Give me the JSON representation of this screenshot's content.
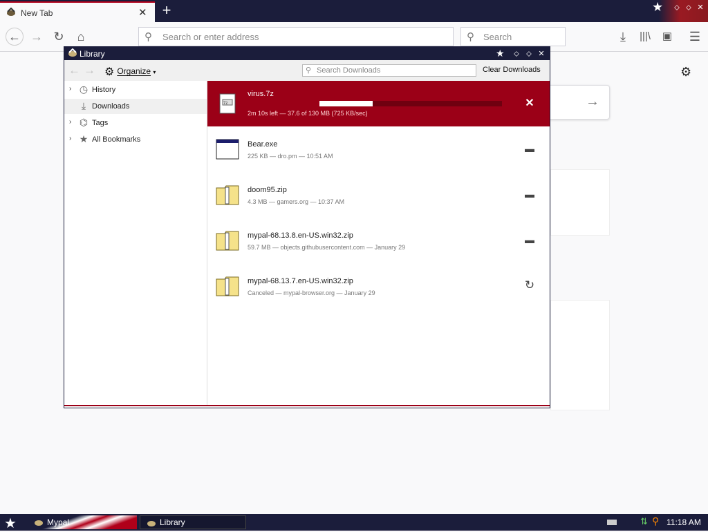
{
  "browser": {
    "tab_title": "New Tab",
    "url_placeholder": "Search or enter address",
    "search_placeholder": "Search"
  },
  "library": {
    "window_title": "Library",
    "organize_label": "Organize",
    "search_placeholder": "Search Downloads",
    "clear_label": "Clear Downloads",
    "sidebar": [
      {
        "label": "History",
        "icon": "clock-icon",
        "expandable": true,
        "selected": false
      },
      {
        "label": "Downloads",
        "icon": "download-icon",
        "expandable": false,
        "selected": true
      },
      {
        "label": "Tags",
        "icon": "tag-icon",
        "expandable": true,
        "selected": false
      },
      {
        "label": "All Bookmarks",
        "icon": "star-icon",
        "expandable": true,
        "selected": false
      }
    ],
    "downloads": [
      {
        "name": "virus.7z",
        "status": "2m 10s left — 37.6 of 130 MB (725 KB/sec)",
        "progress": 0.29,
        "action": "cancel-icon",
        "active": true
      },
      {
        "name": "Bear.exe",
        "status": "225 KB — dro.pm — 10:51 AM",
        "action": "folder-icon",
        "active": false
      },
      {
        "name": "doom95.zip",
        "status": "4.3 MB — gamers.org — 10:37 AM",
        "action": "folder-icon",
        "active": false
      },
      {
        "name": "mypal-68.13.8.en-US.win32.zip",
        "status": "59.7 MB — objects.githubusercontent.com — January 29",
        "action": "folder-icon",
        "active": false
      },
      {
        "name": "mypal-68.13.7.en-US.win32.zip",
        "status": "Canceled — mypal-browser.org — January 29",
        "action": "retry-icon",
        "active": false
      }
    ]
  },
  "taskbar": {
    "mypal_label": "Mypal",
    "library_label": "Library",
    "clock": "11:18 AM"
  },
  "colors": {
    "navy": "#1b1d3b",
    "accent_red": "#9b0017"
  }
}
